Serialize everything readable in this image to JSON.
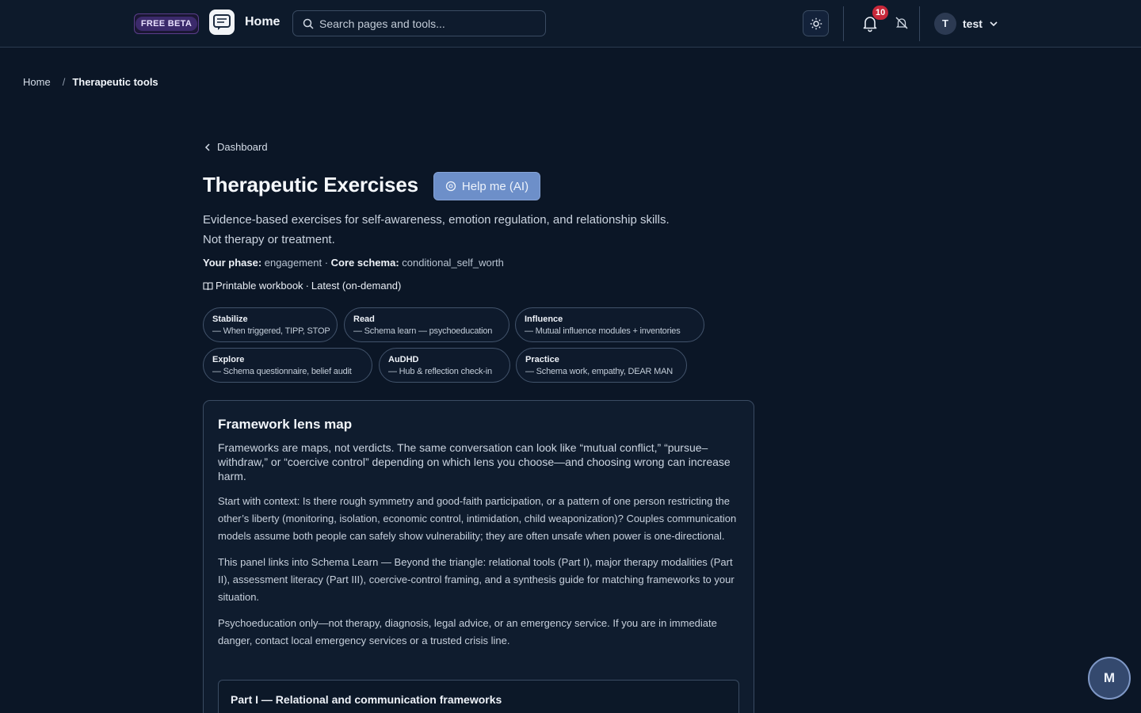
{
  "header": {
    "beta_badge": "FREE BETA",
    "home_label": "Home",
    "search_placeholder": "Search pages and tools...",
    "notification_count": "10",
    "user_initial": "T",
    "user_name": "test"
  },
  "breadcrumb": {
    "home": "Home",
    "separator": "/",
    "current": "Therapeutic tools"
  },
  "page": {
    "back_label": "Dashboard",
    "title": "Therapeutic Exercises",
    "help_button": "Help me (AI)",
    "subtitle_line1": "Evidence-based exercises for self-awareness, emotion regulation, and relationship skills.",
    "subtitle_line2": "Not therapy or treatment.",
    "phase_label": "Your phase:",
    "phase_value": "engagement",
    "phase_sep": "·",
    "schema_label": "Core schema:",
    "schema_value": "conditional_self_worth",
    "workbook_label": "Printable workbook",
    "workbook_sep": "·",
    "workbook_version": "Latest (on-demand)"
  },
  "chips": [
    {
      "title": "Stabilize",
      "desc": "— When triggered, TIPP, STOP"
    },
    {
      "title": "Read",
      "desc": "— Schema learn — psychoeducation"
    },
    {
      "title": "Influence",
      "desc": "— Mutual influence modules + inventories"
    },
    {
      "title": "Explore",
      "desc": "— Schema questionnaire, belief audit"
    },
    {
      "title": "AuDHD",
      "desc": "— Hub & reflection check-in"
    },
    {
      "title": "Practice",
      "desc": "— Schema work, empathy, DEAR MAN"
    }
  ],
  "framework_card": {
    "title": "Framework lens map",
    "intro": "Frameworks are maps, not verdicts. The same conversation can look like “mutual conflict,” “pursue–withdraw,” or “coercive control” depending on which lens you choose—and choosing wrong can increase harm.",
    "para1": "Start with context: Is there rough symmetry and good-faith participation, or a pattern of one person restricting the other’s liberty (monitoring, isolation, economic control, intimidation, child weaponization)? Couples communication models assume both people can safely show vulnerability; they are often unsafe when power is one-directional.",
    "para2": "This panel links into Schema Learn — Beyond the triangle: relational tools (Part I), major therapy modalities (Part II), assessment literacy (Part III), coercive-control framing, and a synthesis guide for matching frameworks to your situation.",
    "para3": "Psychoeducation only—not therapy, diagnosis, legal advice, or an emergency service. If you are in immediate danger, contact local emergency services or a trusted crisis line.",
    "part1_title": "Part I — Relational and communication frameworks"
  },
  "fab": {
    "label": "M"
  },
  "colors": {
    "background": "#0b1626",
    "accent": "#6d8fc9",
    "badge": "#c8283a",
    "beta": "#3b2a6b"
  }
}
